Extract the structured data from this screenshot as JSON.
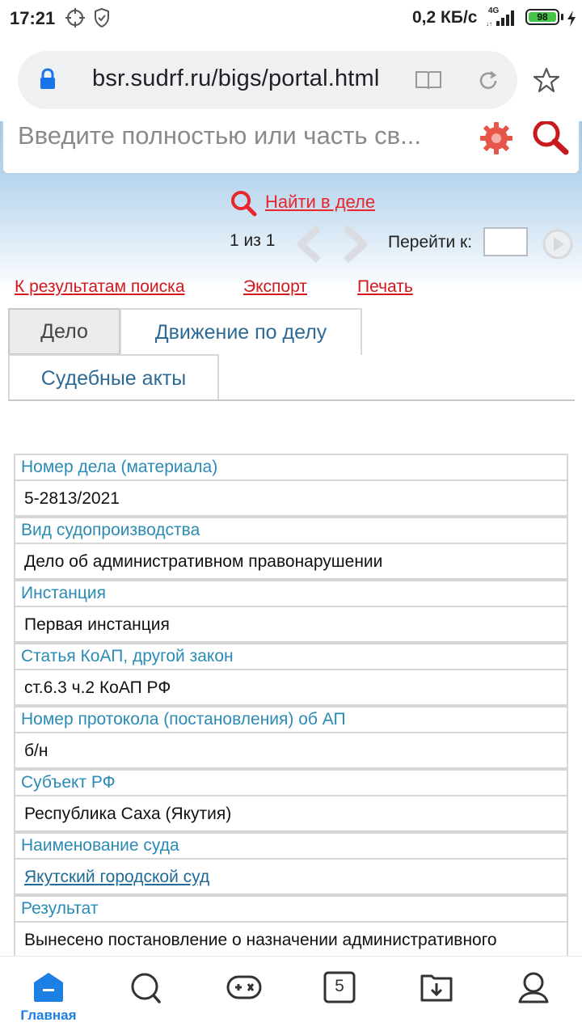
{
  "status_bar": {
    "time": "17:21",
    "network_speed": "0,2 КБ/с",
    "network_type": "4G",
    "battery": "98",
    "icons": [
      "crosshair-icon",
      "shield-check-icon",
      "signal-icon",
      "battery-icon",
      "charging-bolt-icon"
    ]
  },
  "browser": {
    "url": "bsr.sudrf.ru/bigs/portal.html",
    "icons": [
      "lock-icon",
      "reader-mode-icon",
      "reload-icon",
      "bookmark-star-icon"
    ]
  },
  "search": {
    "placeholder": "Введите полностью или часть св...",
    "icons": [
      "settings-gear-icon",
      "search-icon"
    ]
  },
  "find_in_case": {
    "label": "Найти в деле"
  },
  "pager": {
    "position": "1 из 1",
    "goto_label": "Перейти к:",
    "goto_value": ""
  },
  "actions": {
    "back_to_results": "К результатам поиска",
    "export": "Экспорт",
    "print": "Печать"
  },
  "tabs": [
    {
      "label": "Дело",
      "active": true
    },
    {
      "label": "Движение по делу",
      "active": false
    },
    {
      "label": "Судебные акты",
      "active": false
    }
  ],
  "case_fields": [
    {
      "label": "Номер дела (материала)",
      "value": "5-2813/2021"
    },
    {
      "label": "Вид судопроизводства",
      "value": "Дело об административном правонарушении"
    },
    {
      "label": "Инстанция",
      "value": "Первая инстанция"
    },
    {
      "label": "Статья КоАП, другой закон",
      "value": "ст.6.3 ч.2 КоАП РФ"
    },
    {
      "label": "Номер протокола (постановления) об АП",
      "value": "б/н"
    },
    {
      "label": "Субъект РФ",
      "value": "Республика Саха (Якутия)"
    },
    {
      "label": "Наименование суда",
      "value": "Якутский городской суд"
    },
    {
      "label": "Результат",
      "value": "Вынесено постановление о назначении административного"
    }
  ],
  "bottom_nav": {
    "home_label": "Главная",
    "tabs_count": "5",
    "colors": {
      "accent": "#1b7fe3",
      "icon": "#333333"
    }
  },
  "colors": {
    "link_red": "#d4181e",
    "label_blue": "#2b8bb5",
    "tab_blue": "#2d6b96"
  }
}
